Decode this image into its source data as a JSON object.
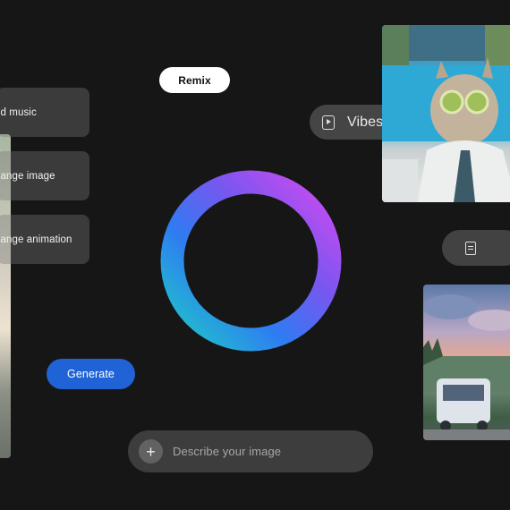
{
  "menu": {
    "items": [
      {
        "label": "dd music"
      },
      {
        "label": "hange image"
      },
      {
        "label": "hange animation"
      }
    ]
  },
  "remix_label": "Remix",
  "vibes_label": "Vibes",
  "generate_label": "Generate",
  "prompt": {
    "placeholder": "Describe your image",
    "add_symbol": "+"
  },
  "icons": {
    "vibes": "play-square-icon",
    "doc": "document-icon",
    "add": "plus-icon"
  },
  "colors": {
    "background": "#161616",
    "generate": "#1f63d6",
    "ring_gradient": [
      "#d24af0",
      "#7a56f0",
      "#2e7cf2",
      "#20c8c8"
    ]
  }
}
